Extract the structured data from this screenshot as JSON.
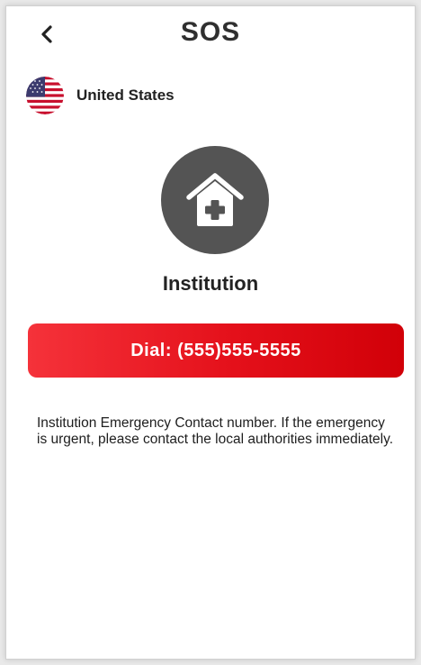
{
  "header": {
    "title": "SOS",
    "back_icon": "chevron-left-icon"
  },
  "country": {
    "name": "United States",
    "flag_icon": "us-flag-icon"
  },
  "category": {
    "label": "Institution",
    "icon": "house-medical-icon",
    "icon_bg_color": "#545454"
  },
  "dial": {
    "label": "Dial: (555)555-5555",
    "color": "#e4101a"
  },
  "description": {
    "text": "Institution Emergency Contact number. If the emergency is urgent, please contact the local authorities immediately."
  }
}
